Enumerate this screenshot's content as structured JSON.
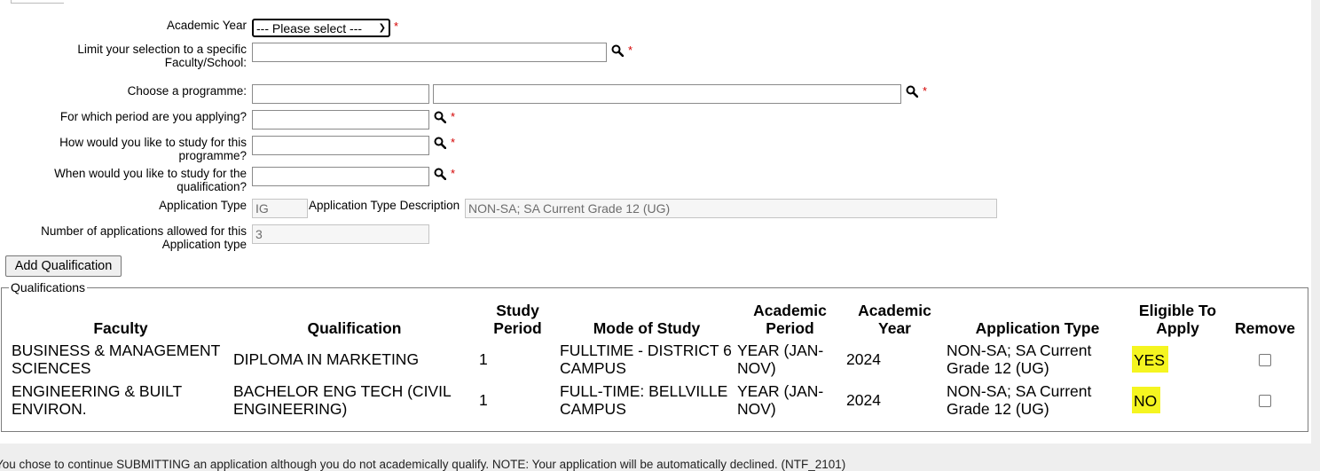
{
  "form": {
    "academic_year": {
      "label": "Academic Year",
      "selected": "--- Please select ---"
    },
    "faculty": {
      "label_line1": "Limit your selection to a specific",
      "label_line2": "Faculty/School:",
      "value": ""
    },
    "programme": {
      "label": "Choose a programme:",
      "code": "",
      "name": ""
    },
    "period": {
      "label": "For which period are you applying?",
      "value": ""
    },
    "study_mode": {
      "label_line1": "How would you like to study for this",
      "label_line2": "programme?",
      "value": ""
    },
    "study_when": {
      "label_line1": "When would you like to study for the",
      "label_line2": "qualification?",
      "value": ""
    },
    "application_type": {
      "label": "Application Type",
      "value": "IG",
      "description_label": "Application Type Description",
      "description_value": "NON-SA; SA Current Grade 12 (UG)"
    },
    "num_applications": {
      "label_line1": "Number of applications allowed for this",
      "label_line2": "Application type",
      "value": "3"
    },
    "required_mark": "*",
    "add_button": "Add Qualification"
  },
  "qualifications": {
    "legend": "Qualifications",
    "headers": {
      "faculty": "Faculty",
      "qualification": "Qualification",
      "study_period_1": "Study",
      "study_period_2": "Period",
      "mode": "Mode of Study",
      "acad_period_1": "Academic",
      "acad_period_2": "Period",
      "acad_year_1": "Academic",
      "acad_year_2": "Year",
      "app_type": "Application Type",
      "eligible_1": "Eligible To",
      "eligible_2": "Apply",
      "remove": "Remove"
    },
    "rows": [
      {
        "faculty": "BUSINESS & MANAGEMENT SCIENCES",
        "qualification": "DIPLOMA IN MARKETING",
        "study_period": "1",
        "mode": "FULLTIME - DISTRICT 6 CAMPUS",
        "academic_period": "YEAR (JAN-NOV)",
        "academic_year": "2024",
        "application_type": "NON-SA; SA Current Grade 12 (UG)",
        "eligible": "YES"
      },
      {
        "faculty": "ENGINEERING & BUILT ENVIRON.",
        "qualification": "BACHELOR ENG TECH (CIVIL ENGINEERING)",
        "study_period": "1",
        "mode": "FULL-TIME: BELLVILLE CAMPUS",
        "academic_period": "YEAR (JAN-NOV)",
        "academic_year": "2024",
        "application_type": "NON-SA; SA Current Grade 12 (UG)",
        "eligible": "NO"
      }
    ]
  },
  "footer_note": "You chose to continue SUBMITTING an application although you do not academically qualify. NOTE: Your application will be automatically declined. (NTF_2101)",
  "colors": {
    "highlight": "#f5f520",
    "required": "#d40000"
  }
}
